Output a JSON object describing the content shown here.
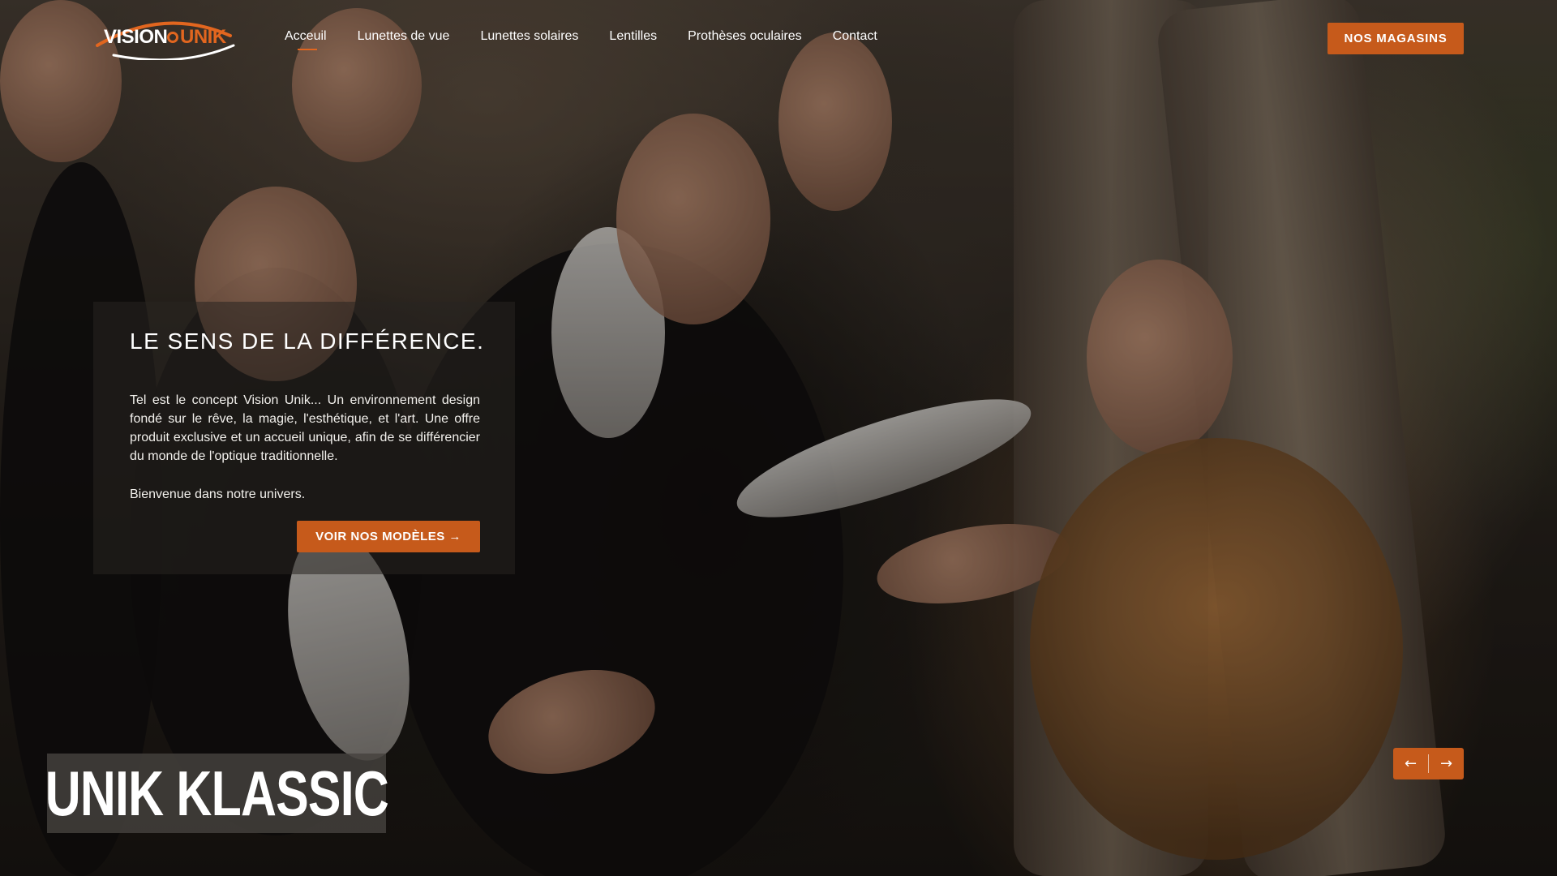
{
  "header": {
    "logo": {
      "word1": "VISION",
      "word2": "UNIK"
    },
    "nav": [
      {
        "label": "Acceuil",
        "active": true
      },
      {
        "label": "Lunettes de vue"
      },
      {
        "label": "Lunettes solaires"
      },
      {
        "label": "Lentilles"
      },
      {
        "label": "Prothèses oculaires"
      },
      {
        "label": "Contact"
      }
    ],
    "stores_button": "NOS MAGASINS"
  },
  "hero": {
    "title": "LE SENS DE LA DIFFÉRENCE.",
    "text": "Tel est le concept Vision Unik... Un environnement design fondé sur le rêve, la magie, l'esthétique, et l'art. Une offre produit exclusive et un accueil unique, afin de se différencier du monde de l'optique traditionnelle.",
    "welcome": "Bienvenue dans notre univers.",
    "cta": "VOIR NOS MODÈLES →"
  },
  "brand_label": "UNIK KLASSIC",
  "slider": {
    "prev": "←",
    "next": "→"
  },
  "colors": {
    "accent": "#c65a1b",
    "logo_orange": "#e2661f"
  },
  "icons": {
    "prev": "arrow-left-icon",
    "next": "arrow-right-icon"
  }
}
